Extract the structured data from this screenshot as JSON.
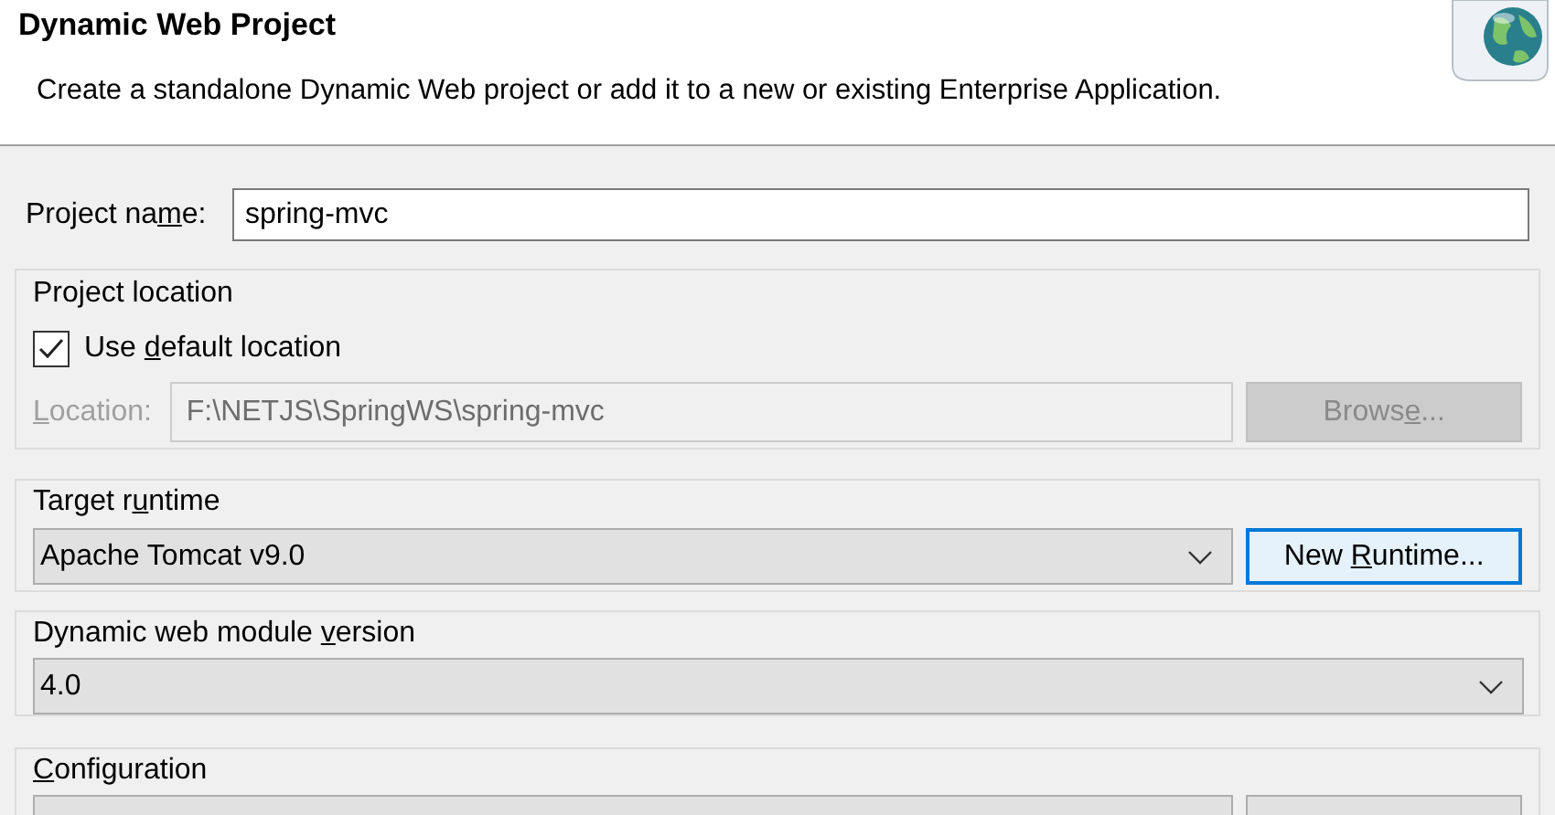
{
  "header": {
    "title": "Dynamic Web Project",
    "description": "Create a standalone Dynamic Web project or add it to a new or existing Enterprise Application."
  },
  "project_name": {
    "label": {
      "pre": "Project na",
      "key": "m",
      "post": "e:"
    },
    "value": "spring-mvc"
  },
  "project_location": {
    "title": "Project location",
    "use_default": {
      "label": {
        "pre": "Use ",
        "key": "d",
        "post": "efault location"
      },
      "checked": true
    },
    "location": {
      "label": {
        "key": "L",
        "post": "ocation:"
      },
      "value": "F:\\NETJS\\SpringWS\\spring-mvc",
      "disabled": true
    },
    "browse": {
      "label": {
        "pre": "Brows",
        "key": "e",
        "post": "..."
      },
      "disabled": true
    }
  },
  "target_runtime": {
    "title": {
      "pre": "Target r",
      "key": "u",
      "post": "ntime"
    },
    "value": "Apache Tomcat v9.0",
    "button": {
      "pre": "New ",
      "key": "R",
      "post": "untime..."
    }
  },
  "module_version": {
    "title": {
      "pre": "Dynamic web module ",
      "key": "v",
      "post": "ersion"
    },
    "value": "4.0"
  },
  "configuration": {
    "title": {
      "key": "C",
      "post": "onfiguration"
    }
  }
}
